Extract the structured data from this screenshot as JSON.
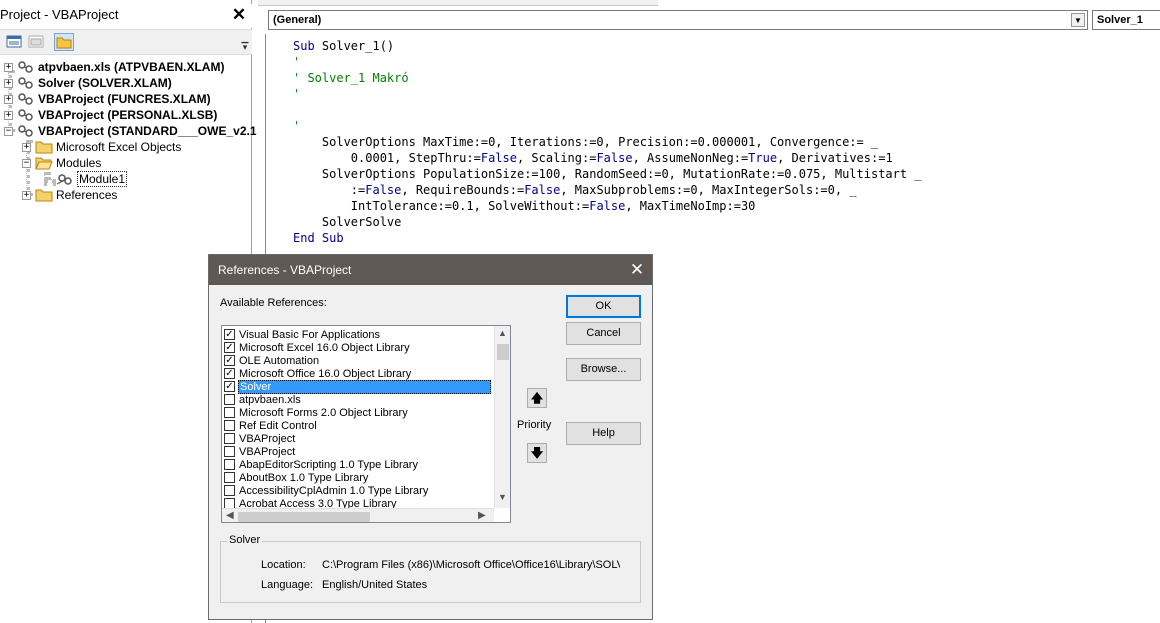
{
  "project": {
    "title": "Project - VBAProject",
    "close_glyph": "✕",
    "tree": [
      {
        "label": "atpvbaen.xls (ATPVBAEN.XLAM)",
        "expander": "+",
        "icon": "vba-project-icon"
      },
      {
        "label": "Solver (SOLVER.XLAM)",
        "expander": "+",
        "icon": "vba-project-icon"
      },
      {
        "label": "VBAProject (FUNCRES.XLAM)",
        "expander": "+",
        "icon": "vba-project-icon"
      },
      {
        "label": "VBAProject (PERSONAL.XLSB)",
        "expander": "+",
        "icon": "vba-project-icon"
      },
      {
        "label": "VBAProject (STANDARD___OWE_v2.1",
        "expander": "−",
        "icon": "vba-project-icon"
      },
      {
        "label": "Microsoft Excel Objects",
        "expander": "+",
        "icon": "folder-icon"
      },
      {
        "label": "Modules",
        "expander": "−",
        "icon": "open-folder-icon"
      },
      {
        "label": "Module1",
        "expander": "",
        "icon": "module-icon"
      },
      {
        "label": "References",
        "expander": "+",
        "icon": "folder-icon"
      }
    ]
  },
  "code_window": {
    "object_combo": "(General)",
    "procedure_combo": "Solver_1",
    "lines": [
      [
        {
          "t": "Sub ",
          "c": "kw"
        },
        {
          "t": "Solver_1()",
          "c": ""
        }
      ],
      [
        {
          "t": "'",
          "c": "cm"
        }
      ],
      [
        {
          "t": "' Solver_1 Makró",
          "c": "cm"
        }
      ],
      [
        {
          "t": "'",
          "c": "cm"
        }
      ],
      [
        {
          "t": "",
          "c": ""
        }
      ],
      [
        {
          "t": "'",
          "c": "cm"
        }
      ],
      [
        {
          "t": "    SolverOptions MaxTime:=0, Iterations:=0, Precision:=0.000001, Convergence:= _",
          "c": ""
        }
      ],
      [
        {
          "t": "        0.0001, StepThru:=",
          "c": ""
        },
        {
          "t": "False",
          "c": "kw"
        },
        {
          "t": ", Scaling:=",
          "c": ""
        },
        {
          "t": "False",
          "c": "kw"
        },
        {
          "t": ", AssumeNonNeg:=",
          "c": ""
        },
        {
          "t": "True",
          "c": "kw"
        },
        {
          "t": ", Derivatives:=1",
          "c": ""
        }
      ],
      [
        {
          "t": "    SolverOptions PopulationSize:=100, RandomSeed:=0, MutationRate:=0.075, Multistart _",
          "c": ""
        }
      ],
      [
        {
          "t": "        :=",
          "c": ""
        },
        {
          "t": "False",
          "c": "kw"
        },
        {
          "t": ", RequireBounds:=",
          "c": ""
        },
        {
          "t": "False",
          "c": "kw"
        },
        {
          "t": ", MaxSubproblems:=0, MaxIntegerSols:=0, _",
          "c": ""
        }
      ],
      [
        {
          "t": "        IntTolerance:=0.1, SolveWithout:=",
          "c": ""
        },
        {
          "t": "False",
          "c": "kw"
        },
        {
          "t": ", MaxTimeNoImp:=30",
          "c": ""
        }
      ],
      [
        {
          "t": "    SolverSolve",
          "c": ""
        }
      ],
      [
        {
          "t": "End Sub",
          "c": "kw"
        }
      ]
    ]
  },
  "references_dialog": {
    "title": "References - VBAProject",
    "close_glyph": "✕",
    "available_label": "Available References:",
    "references": [
      {
        "label": "Visual Basic For Applications",
        "checked": true,
        "selected": false
      },
      {
        "label": "Microsoft Excel 16.0 Object Library",
        "checked": true,
        "selected": false
      },
      {
        "label": "OLE Automation",
        "checked": true,
        "selected": false
      },
      {
        "label": "Microsoft Office 16.0 Object Library",
        "checked": true,
        "selected": false
      },
      {
        "label": "Solver",
        "checked": true,
        "selected": true
      },
      {
        "label": "atpvbaen.xls",
        "checked": false,
        "selected": false
      },
      {
        "label": "Microsoft Forms 2.0 Object Library",
        "checked": false,
        "selected": false
      },
      {
        "label": "Ref Edit Control",
        "checked": false,
        "selected": false
      },
      {
        "label": "VBAProject",
        "checked": false,
        "selected": false
      },
      {
        "label": "VBAProject",
        "checked": false,
        "selected": false
      },
      {
        "label": "AbapEditorScripting 1.0 Type Library",
        "checked": false,
        "selected": false
      },
      {
        "label": "AboutBox 1.0 Type Library",
        "checked": false,
        "selected": false
      },
      {
        "label": "AccessibilityCplAdmin 1.0 Type Library",
        "checked": false,
        "selected": false
      },
      {
        "label": "Acrobat Access 3.0 Type Library",
        "checked": false,
        "selected": false
      }
    ],
    "buttons": {
      "ok": "OK",
      "cancel": "Cancel",
      "browse": "Browse...",
      "help": "Help",
      "priority_up": "🡅",
      "priority_down": "🡇"
    },
    "priority_label": "Priority",
    "details": {
      "group_title": "Solver",
      "location_label": "Location:",
      "location_value": "C:\\Program Files (x86)\\Microsoft Office\\Office16\\Library\\SOLV",
      "language_label": "Language:",
      "language_value": "English/United States"
    }
  }
}
